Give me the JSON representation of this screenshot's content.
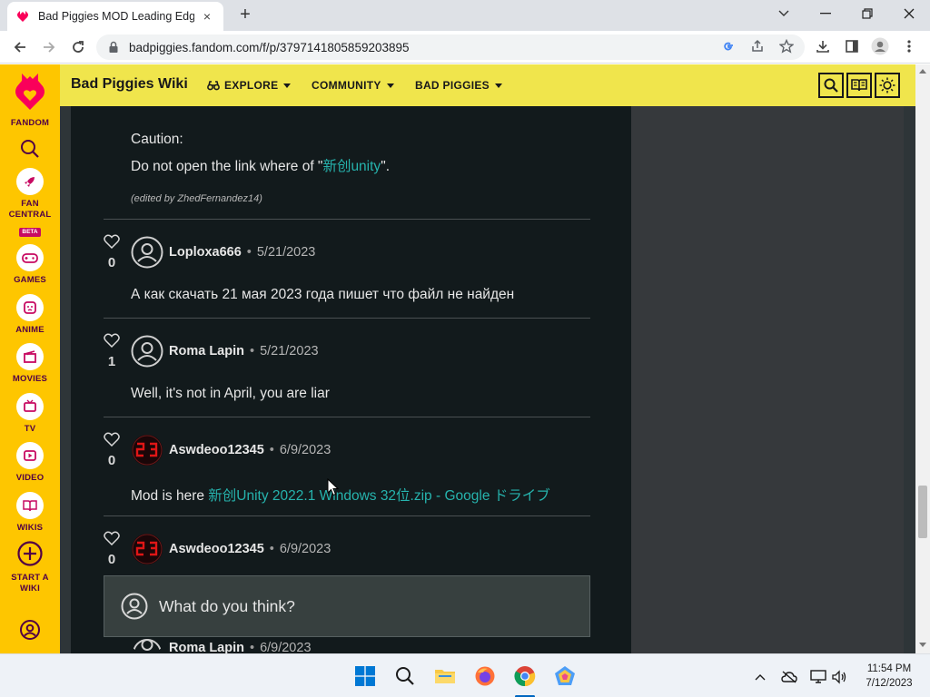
{
  "browser": {
    "tab_title": "Bad Piggies MOD Leading Edge (",
    "tab_close": "×",
    "new_tab": "+",
    "url": "badpiggies.fandom.com/f/p/3797141805859203895"
  },
  "rail": {
    "items": [
      {
        "label": "FANDOM",
        "icon": "fandom-logo-icon"
      },
      {
        "label": "",
        "icon": "search-icon"
      },
      {
        "label": "FAN CENTRAL",
        "icon": "rocket-icon",
        "badge": "BETA"
      },
      {
        "label": "GAMES",
        "icon": "gamepad-icon"
      },
      {
        "label": "ANIME",
        "icon": "anime-icon"
      },
      {
        "label": "MOVIES",
        "icon": "clapperboard-icon"
      },
      {
        "label": "TV",
        "icon": "tv-icon"
      },
      {
        "label": "VIDEO",
        "icon": "play-icon"
      },
      {
        "label": "WIKIS",
        "icon": "book-icon"
      },
      {
        "label": "START A WIKI",
        "icon": "plus-circle-icon"
      },
      {
        "label": "",
        "icon": "user-icon"
      }
    ]
  },
  "wikinav": {
    "wiki_name": "Bad Piggies Wiki",
    "links": [
      "EXPLORE",
      "COMMUNITY",
      "BAD PIGGIES"
    ]
  },
  "post": {
    "caution_label": "Caution:",
    "caution_text_before": "Do not open the link where of \"",
    "caution_link": "新创unity",
    "caution_text_after": "\".",
    "edited_by": "(edited by ZhedFernandez14)"
  },
  "replies": [
    {
      "author": "Loploxa666",
      "date": "5/21/2023",
      "likes": "0",
      "text": "А как скачать 21 мая 2023 года пишет что файл не найден",
      "avatar": "default"
    },
    {
      "author": "Roma Lapin",
      "date": "5/21/2023",
      "likes": "1",
      "text": "Well, it's not in April, you are liar",
      "avatar": "default"
    },
    {
      "author": "Aswdeoo12345",
      "date": "6/9/2023",
      "likes": "0",
      "text_before": "Mod is here ",
      "link": "新创Unity 2022.1 Windows 32位.zip - Google ドライブ",
      "avatar": "custom"
    },
    {
      "author": "Aswdeoo12345",
      "date": "6/9/2023",
      "likes": "0",
      "avatar": "custom"
    },
    {
      "author": "Roma Lapin",
      "date": "6/9/2023",
      "avatar": "default"
    }
  ],
  "reply_box": {
    "placeholder": "What do you think?"
  },
  "taskbar": {
    "time": "11:54 PM",
    "date": "7/12/2023"
  },
  "colors": {
    "rail_bg": "#fec600",
    "nav_bg": "#f0e54c",
    "content_bg": "#121a1c",
    "link": "#26b3ad"
  }
}
